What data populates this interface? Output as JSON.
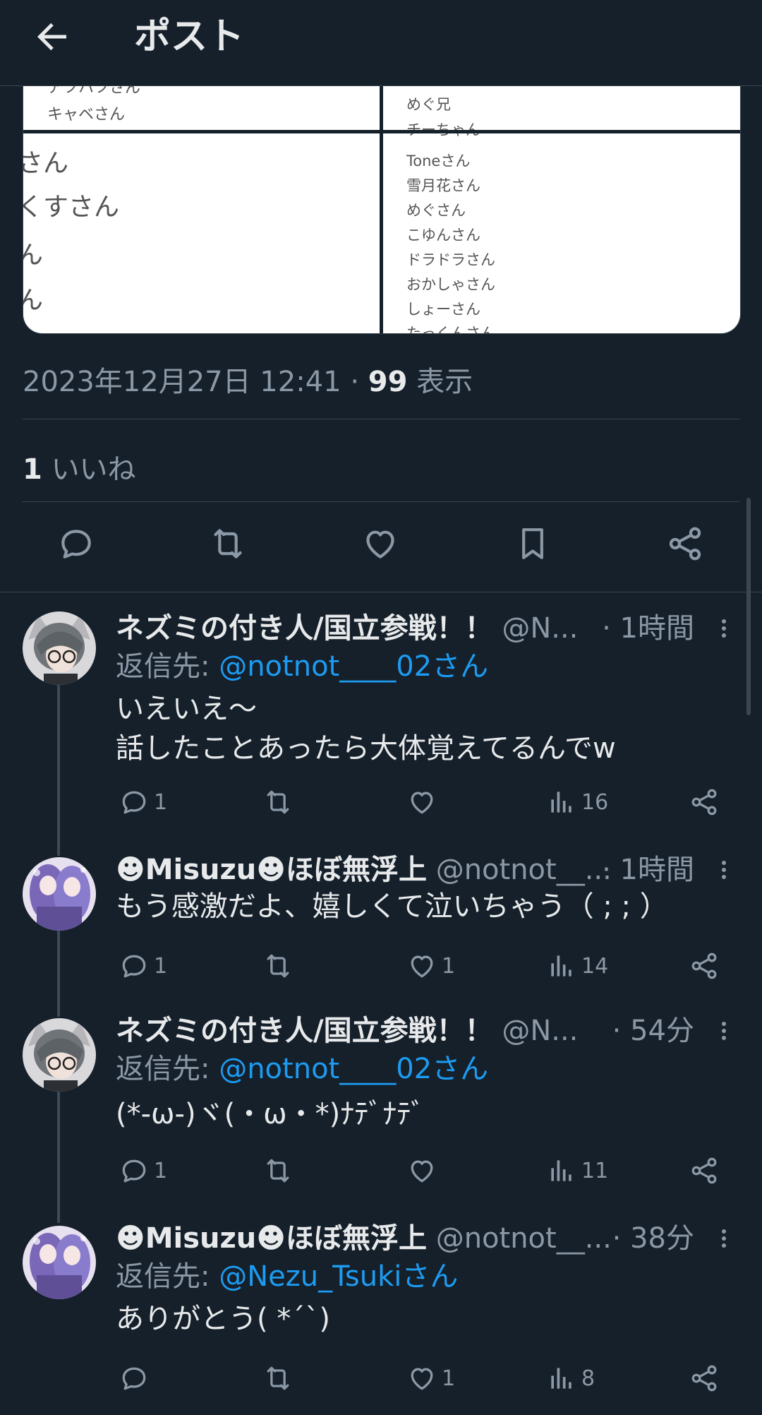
{
  "header": {
    "title": "ポスト"
  },
  "media": {
    "left_top_small": [
      "アツハツさん",
      "キャベさん"
    ],
    "left_big": [
      "さん",
      "くすさん",
      "ん",
      "ん"
    ],
    "right_top": [
      "めぐ兄",
      "チーちゃん"
    ],
    "right_list": [
      "Toneさん",
      "雪月花さん",
      "めぐさん",
      "こゆんさん",
      "ドラドラさん",
      "おかしゃさん",
      "しょーさん",
      "たっくんさん"
    ]
  },
  "post_meta": {
    "datetime": "2023年12月27日 12:41",
    "separator": "·",
    "views_count": "99",
    "views_label": "表示"
  },
  "post_stats": {
    "likes_count": "1",
    "likes_label": "いいね"
  },
  "colors": {
    "background": "#15202b",
    "link": "#1d9bf0",
    "muted": "#8b98a5",
    "text": "#e7e9ea",
    "divider": "#38444d"
  },
  "replies": [
    {
      "name": "ネズミの付き人/国立参戦！！",
      "handle": "@N...",
      "time": "· 1時間",
      "reply_to_label": "返信先: ",
      "reply_to_handle": "@notnot____02さん",
      "text": "いえいえ～\n話したことあったら大体覚えてるんでw",
      "replies": "1",
      "retweets": "",
      "likes": "",
      "views": "16"
    },
    {
      "name": "☻Misuzu☻ほぼ無浮上",
      "handle": "@notnot__...",
      "time": "· 1時間",
      "text": "もう感激だよ、嬉しくて泣いちゃう（ ; ; ）",
      "replies": "1",
      "retweets": "",
      "likes": "1",
      "views": "14"
    },
    {
      "name": "ネズミの付き人/国立参戦！！",
      "handle": "@N...",
      "time": "· 54分",
      "reply_to_label": "返信先: ",
      "reply_to_handle": "@notnot____02さん",
      "text": "(*-ω-)ヾ(・ω・*)ﾅﾃﾞﾅﾃﾞ",
      "replies": "1",
      "retweets": "",
      "likes": "",
      "views": "11"
    },
    {
      "name": "☻Misuzu☻ほぼ無浮上",
      "handle": "@notnot__...",
      "time": "· 38分",
      "reply_to_label": "返信先: ",
      "reply_to_handle": "@Nezu_Tsukiさん",
      "text": "ありがとう( *´`)",
      "replies": "",
      "retweets": "",
      "likes": "1",
      "views": "8"
    }
  ]
}
